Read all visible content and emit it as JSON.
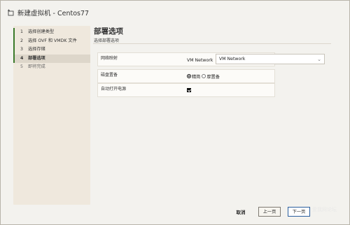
{
  "window": {
    "title": "新建虚拟机 - Centos77",
    "icon": "new-vm-icon"
  },
  "steps": [
    {
      "num": "1",
      "label": "选择创建类型",
      "state": "done"
    },
    {
      "num": "2",
      "label": "选择 OVF 和 VMDK 文件",
      "state": "done"
    },
    {
      "num": "3",
      "label": "选择存储",
      "state": "done"
    },
    {
      "num": "4",
      "label": "部署选项",
      "state": "active"
    },
    {
      "num": "5",
      "label": "即将完成",
      "state": "todo"
    }
  ],
  "main": {
    "title": "部署选项",
    "subtitle": "选择部署选项",
    "network": {
      "label": "网络映射",
      "source": "VM Network",
      "selected": "VM Network"
    },
    "disk": {
      "label": "磁盘置备",
      "options": [
        "精简",
        "厚置备"
      ],
      "selected_index": 0
    },
    "autopower": {
      "label": "自动打开电源",
      "checked": true
    }
  },
  "footer": {
    "cancel": "取消",
    "prev": "上一页",
    "next": "下一页"
  },
  "watermark": "爱我网论坛"
}
